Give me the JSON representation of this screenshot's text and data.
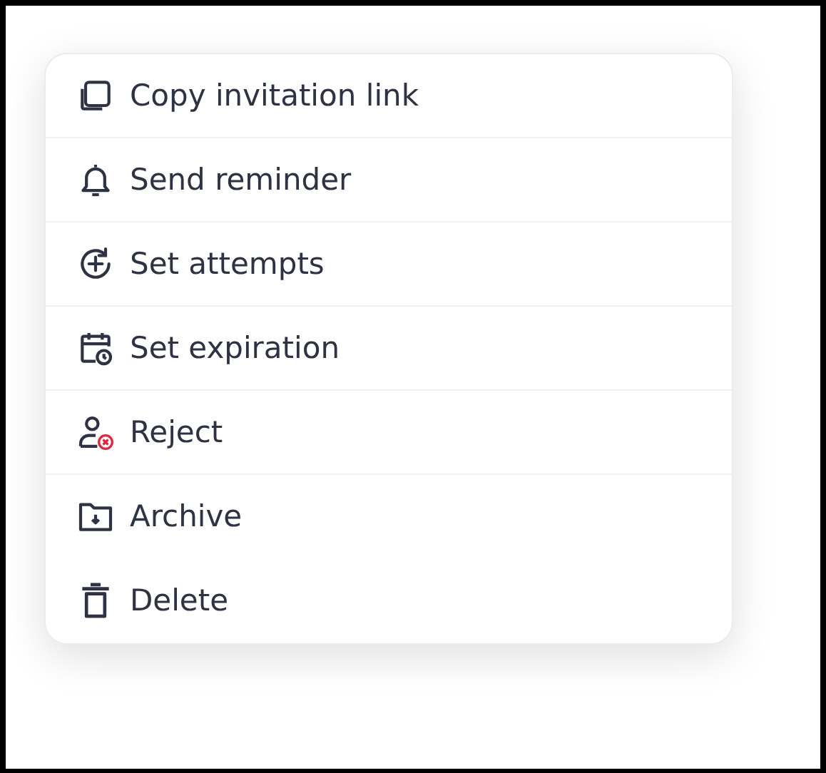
{
  "menu": {
    "items": [
      {
        "kind": "copy",
        "label": "Copy invitation link",
        "divider": true
      },
      {
        "kind": "bell",
        "label": "Send reminder",
        "divider": true
      },
      {
        "kind": "attempts",
        "label": "Set attempts",
        "divider": true
      },
      {
        "kind": "expiration",
        "label": "Set expiration",
        "divider": true
      },
      {
        "kind": "reject",
        "label": "Reject",
        "divider": true
      },
      {
        "kind": "archive",
        "label": "Archive",
        "divider": false
      },
      {
        "kind": "delete",
        "label": "Delete",
        "divider": false
      }
    ]
  }
}
